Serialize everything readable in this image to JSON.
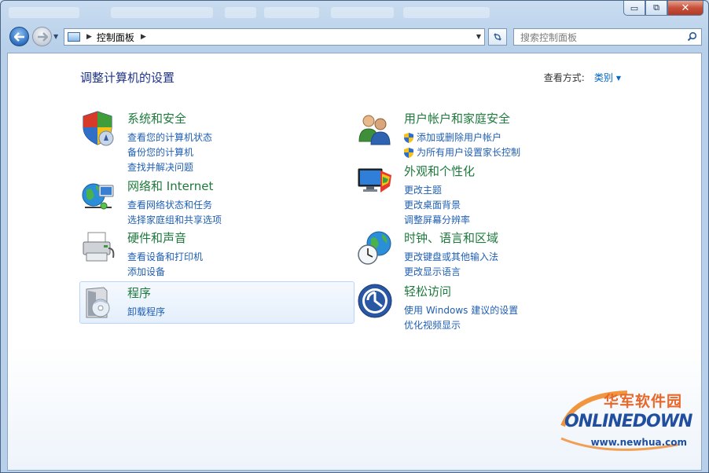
{
  "window": {
    "caption_buttons": {
      "minimize": "▭",
      "restore": "⧉",
      "close": "✕"
    }
  },
  "navbar": {
    "address_path": "控制面板",
    "search_placeholder": "搜索控制面板"
  },
  "main": {
    "heading": "调整计算机的设置",
    "view_by_label": "查看方式:",
    "view_by_value": "类别"
  },
  "categories": {
    "system": {
      "icon": "shield-icon",
      "title": "系统和安全",
      "links": [
        "查看您的计算机状态",
        "备份您的计算机",
        "查找并解决问题"
      ]
    },
    "network": {
      "icon": "globe-network-icon",
      "title": "网络和 Internet",
      "links": [
        "查看网络状态和任务",
        "选择家庭组和共享选项"
      ]
    },
    "hardware": {
      "icon": "printer-icon",
      "title": "硬件和声音",
      "links": [
        "查看设备和打印机",
        "添加设备"
      ]
    },
    "programs": {
      "icon": "program-disc-icon",
      "title": "程序",
      "links": [
        "卸载程序"
      ]
    },
    "users": {
      "icon": "users-icon",
      "title": "用户帐户和家庭安全",
      "links": [
        "添加或删除用户帐户",
        "为所有用户设置家长控制"
      ]
    },
    "appearance": {
      "icon": "monitor-palette-icon",
      "title": "外观和个性化",
      "links": [
        "更改主题",
        "更改桌面背景",
        "调整屏幕分辨率"
      ]
    },
    "clock": {
      "icon": "clock-globe-icon",
      "title": "时钟、语言和区域",
      "links": [
        "更改键盘或其他输入法",
        "更改显示语言"
      ]
    },
    "ease": {
      "icon": "ease-of-access-icon",
      "title": "轻松访问",
      "links": [
        "使用 Windows 建议的设置",
        "优化视频显示"
      ]
    }
  },
  "watermark": {
    "cn": "华军软件园",
    "logo": "ONLINEDOWN",
    "url": "www.newhua.com"
  },
  "colors": {
    "category_title": "#1e7a3c",
    "link": "#1f5fb4",
    "heading": "#1e3287"
  }
}
